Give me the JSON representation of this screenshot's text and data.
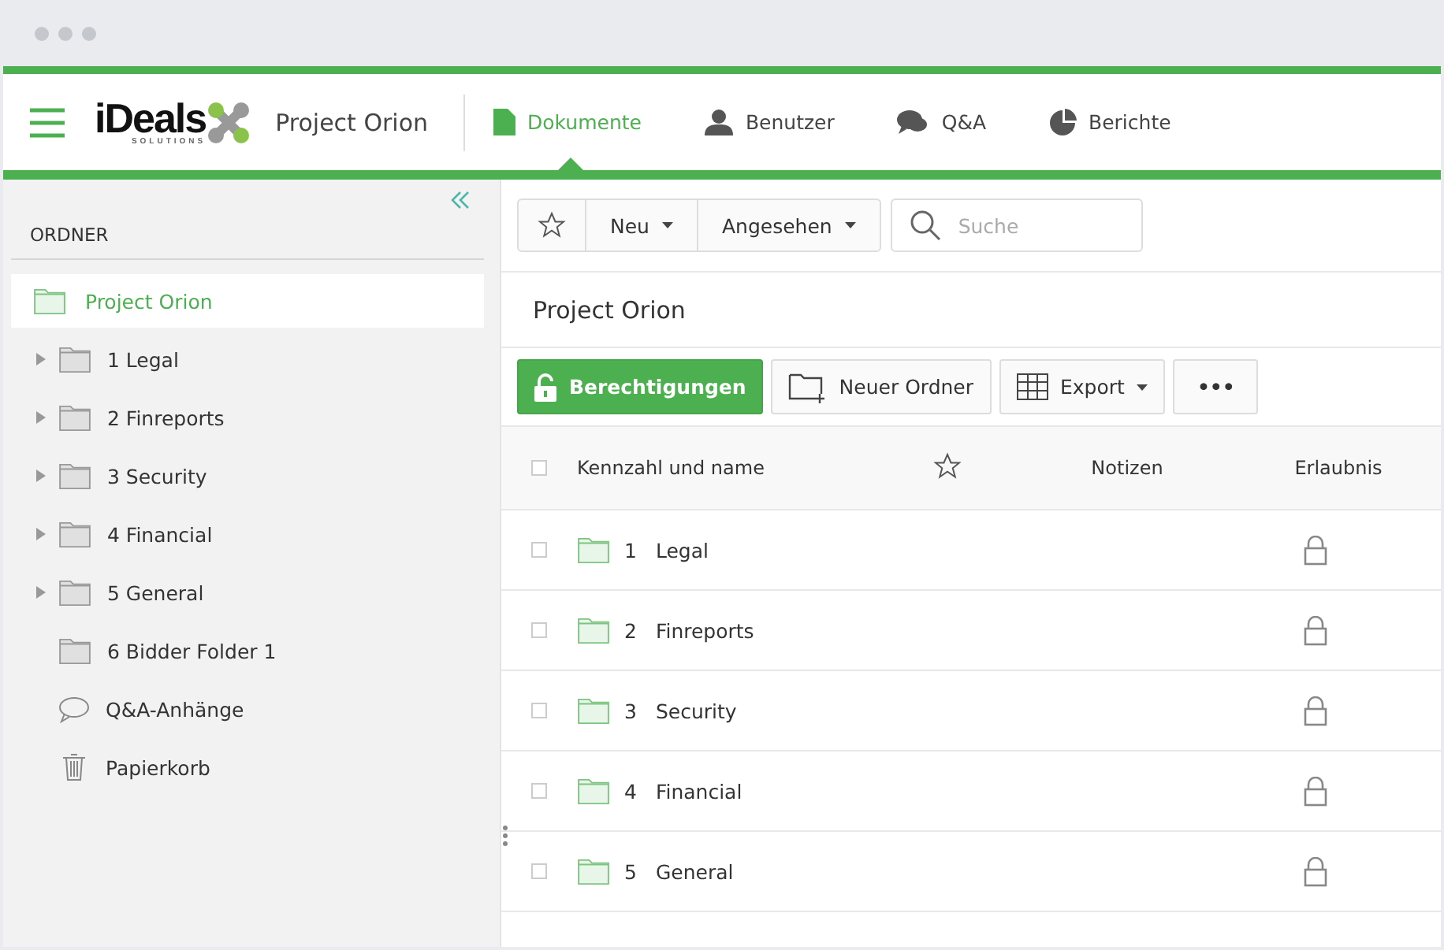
{
  "logo": {
    "word": "iDeals",
    "sub": "SOLUTIONS"
  },
  "project": "Project Orion",
  "nav": [
    {
      "label": "Dokumente",
      "kind": "doc",
      "selected": true
    },
    {
      "label": "Benutzer",
      "kind": "user",
      "selected": false
    },
    {
      "label": "Q&A",
      "kind": "chat",
      "selected": false
    },
    {
      "label": "Berichte",
      "kind": "pie",
      "selected": false
    }
  ],
  "sidebar": {
    "title": "ORDNER",
    "items": [
      {
        "label": "Project Orion",
        "kind": "root",
        "selected": true,
        "expandable": false
      },
      {
        "label": "1 Legal",
        "kind": "folder",
        "selected": false,
        "expandable": true
      },
      {
        "label": "2 Finreports",
        "kind": "folder",
        "selected": false,
        "expandable": true
      },
      {
        "label": "3 Security",
        "kind": "folder",
        "selected": false,
        "expandable": true
      },
      {
        "label": "4 Financial",
        "kind": "folder",
        "selected": false,
        "expandable": true
      },
      {
        "label": "5 General",
        "kind": "folder",
        "selected": false,
        "expandable": true
      },
      {
        "label": "6 Bidder Folder 1",
        "kind": "folder",
        "selected": false,
        "expandable": false
      },
      {
        "label": "Q&A-Anhänge",
        "kind": "qa",
        "selected": false,
        "expandable": false
      },
      {
        "label": "Papierkorb",
        "kind": "trash",
        "selected": false,
        "expandable": false
      }
    ]
  },
  "filters": {
    "new": "Neu",
    "viewed": "Angesehen",
    "search": {
      "placeholder": "Suche"
    }
  },
  "folder_title": "Project Orion",
  "actions": {
    "permissions": "Berechtigungen",
    "new_folder": "Neuer Ordner",
    "export": "Export",
    "more": "•••"
  },
  "table": {
    "columns": [
      "Kennzahl und name",
      "Notizen",
      "Erlaubnis"
    ],
    "all_checked": false,
    "rows": [
      {
        "number": "1",
        "name": "Legal",
        "checked": false
      },
      {
        "number": "2",
        "name": "Finreports",
        "checked": false
      },
      {
        "number": "3",
        "name": "Security",
        "checked": false
      },
      {
        "number": "4",
        "name": "Financial",
        "checked": false
      },
      {
        "number": "5",
        "name": "General",
        "checked": false
      }
    ]
  }
}
